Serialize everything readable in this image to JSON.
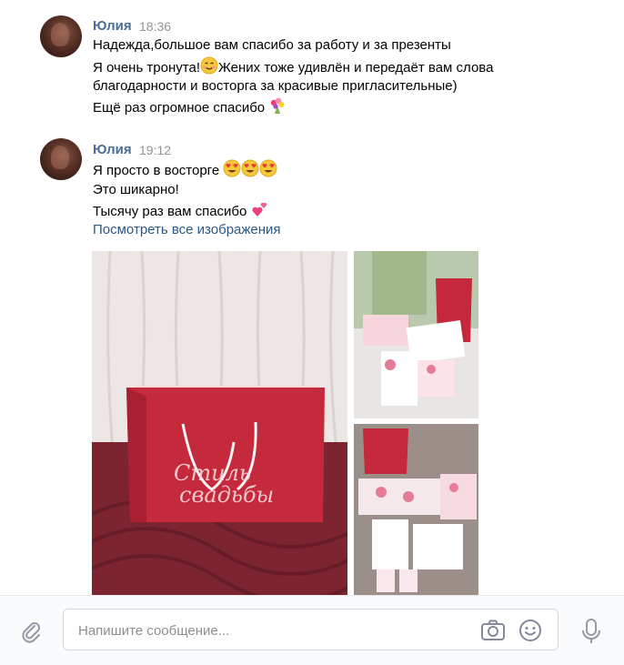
{
  "messages": [
    {
      "author": "Юлия",
      "time": "18:36",
      "lines": [
        "Надежда,большое вам спасибо за работу и за презенты",
        "Я очень тронута!",
        "Жених тоже удивлён и передаёт вам слова",
        "благодарности и восторга за красивые пригласительные)",
        "Ещё раз огромное спасибо"
      ]
    },
    {
      "author": "Юлия",
      "time": "19:12",
      "lines": [
        "Я просто в восторге",
        "Это шикарно!",
        "Тысячу раз вам спасибо"
      ],
      "link": "Посмотреть все изображения",
      "photo_bag_text": "Стиль свадьбы"
    }
  ],
  "composer": {
    "placeholder": "Напишите сообщение..."
  },
  "icons": [
    "paperclip-icon",
    "camera-icon",
    "smile-icon",
    "microphone-icon",
    "smiling-face-emoji",
    "bouquet-emoji",
    "heart-eyes-emoji",
    "two-hearts-emoji"
  ],
  "colors": {
    "author": "#4a6e96",
    "link": "#2a5885",
    "time": "#939393",
    "composer_bg": "#fafbfc"
  }
}
